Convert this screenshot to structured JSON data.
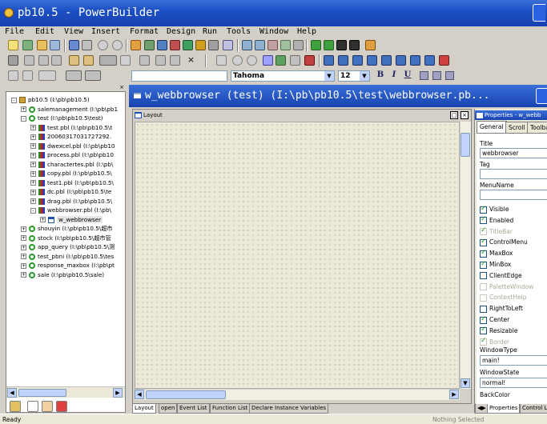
{
  "window": {
    "title": "pb10.5 - PowerBuilder"
  },
  "menu": [
    "File",
    "Edit",
    "View",
    "Insert",
    "Format",
    "Design",
    "Run",
    "Tools",
    "Window",
    "Help"
  ],
  "font_toolbar": {
    "font_name": "Tahoma",
    "font_size": "12",
    "bold": "B",
    "italic": "I",
    "underline": "U"
  },
  "tree": {
    "items": [
      {
        "label": "pb10.5 (I:\\pb\\pb10.5)",
        "icon": "workspace-icon",
        "level": 0,
        "exp": "-"
      },
      {
        "label": "salemanagement (I:\\pb\\pb1",
        "icon": "target-icon",
        "level": 1,
        "exp": "+"
      },
      {
        "label": "test (I:\\pb\\pb10.5\\test)",
        "icon": "target-icon",
        "level": 1,
        "exp": "-"
      },
      {
        "label": "test.pbl (I:\\pb\\pb10.5\\t",
        "icon": "library-icon",
        "level": 2,
        "exp": "+"
      },
      {
        "label": "20060317031727292.",
        "icon": "library-icon",
        "level": 2,
        "exp": "+"
      },
      {
        "label": "dwexcel.pbl (I:\\pb\\pb10",
        "icon": "library-icon",
        "level": 2,
        "exp": "+"
      },
      {
        "label": "process.pbl (I:\\pb\\pb10",
        "icon": "library-icon",
        "level": 2,
        "exp": "+"
      },
      {
        "label": "charactertes.pbl (I:\\pb\\",
        "icon": "library-icon",
        "level": 2,
        "exp": "+"
      },
      {
        "label": "copy.pbl (I:\\pb\\pb10.5\\",
        "icon": "library-icon",
        "level": 2,
        "exp": "+"
      },
      {
        "label": "test1.pbl (I:\\pb\\pb10.5\\",
        "icon": "library-icon",
        "level": 2,
        "exp": "+"
      },
      {
        "label": "dc.pbl (I:\\pb\\pb10.5\\te",
        "icon": "library-icon",
        "level": 2,
        "exp": "+"
      },
      {
        "label": "drag.pbl (I:\\pb\\pb10.5\\",
        "icon": "library-icon",
        "level": 2,
        "exp": "+"
      },
      {
        "label": "webbrowser.pbl (I:\\pb\\",
        "icon": "library-icon",
        "level": 2,
        "exp": "-"
      },
      {
        "label": "w_webbrowser",
        "icon": "window-icon",
        "level": 3,
        "exp": "+",
        "selected": true
      },
      {
        "label": "shouyin (I:\\pb\\pb10.5\\超市",
        "icon": "target-icon",
        "level": 1,
        "exp": "+"
      },
      {
        "label": "stock (I:\\pb\\pb10.5\\超市管",
        "icon": "target-icon",
        "level": 1,
        "exp": "+"
      },
      {
        "label": "app_query (I:\\pb\\pb10.5\\测",
        "icon": "target-icon",
        "level": 1,
        "exp": "+"
      },
      {
        "label": "test_pbni (I:\\pb\\pb10.5\\tes",
        "icon": "target-icon",
        "level": 1,
        "exp": "+"
      },
      {
        "label": "response_maxbox (I:\\pb\\pt",
        "icon": "target-icon",
        "level": 1,
        "exp": "+"
      },
      {
        "label": "sale (I:\\pb\\pb10.5\\sale)",
        "icon": "target-icon",
        "level": 1,
        "exp": "+"
      }
    ]
  },
  "painter": {
    "title": "w_webbrowser (test) (I:\\pb\\pb10.5\\test\\webbrowser.pb...",
    "layout_label": "Layout",
    "tabs": [
      "Layout",
      "open",
      "Event List",
      "Function List",
      "Declare Instance Variables"
    ]
  },
  "properties": {
    "title": "Properties - w_webb",
    "tabs": [
      "General",
      "Scroll",
      "Toolba"
    ],
    "title_label": "Title",
    "title_value": "webbrowser",
    "tag_label": "Tag",
    "menuname_label": "MenuName",
    "checks": [
      {
        "label": "Visible",
        "checked": true,
        "disabled": false
      },
      {
        "label": "Enabled",
        "checked": true,
        "disabled": false
      },
      {
        "label": "TitleBar",
        "checked": true,
        "disabled": true
      },
      {
        "label": "ControlMenu",
        "checked": true,
        "disabled": false
      },
      {
        "label": "MaxBox",
        "checked": true,
        "disabled": false
      },
      {
        "label": "MinBox",
        "checked": true,
        "disabled": false
      },
      {
        "label": "ClientEdge",
        "checked": false,
        "disabled": false
      },
      {
        "label": "PaletteWindow",
        "checked": false,
        "disabled": true
      },
      {
        "label": "ContextHelp",
        "checked": false,
        "disabled": true
      },
      {
        "label": "RightToLeft",
        "checked": false,
        "disabled": false
      },
      {
        "label": "Center",
        "checked": true,
        "disabled": false
      },
      {
        "label": "Resizable",
        "checked": true,
        "disabled": false
      },
      {
        "label": "Border",
        "checked": true,
        "disabled": true
      }
    ],
    "windowtype_label": "WindowType",
    "windowtype_value": "main!",
    "windowstate_label": "WindowState",
    "windowstate_value": "normal!",
    "backcolor_label": "BackColor",
    "bottom_tabs": [
      "Properties",
      "Control L"
    ]
  },
  "status": {
    "left": "Ready",
    "right": "Nothing Selected"
  }
}
